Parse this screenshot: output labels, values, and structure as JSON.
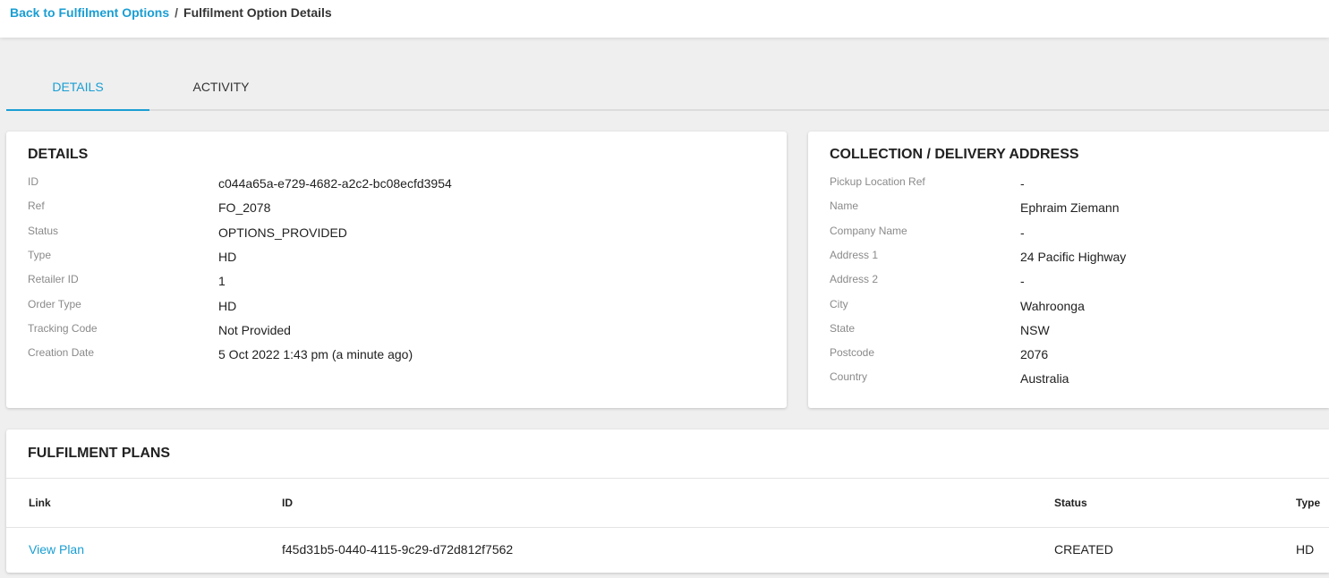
{
  "breadcrumb": {
    "back_label": "Back to Fulfilment Options",
    "separator": "/",
    "current": "Fulfilment Option Details"
  },
  "tabs": [
    {
      "label": "DETAILS",
      "active": true
    },
    {
      "label": "ACTIVITY",
      "active": false
    }
  ],
  "details": {
    "title": "DETAILS",
    "rows": [
      {
        "label": "ID",
        "value": "c044a65a-e729-4682-a2c2-bc08ecfd3954"
      },
      {
        "label": "Ref",
        "value": "FO_2078"
      },
      {
        "label": "Status",
        "value": "OPTIONS_PROVIDED"
      },
      {
        "label": "Type",
        "value": "HD"
      },
      {
        "label": "Retailer ID",
        "value": "1"
      },
      {
        "label": "Order Type",
        "value": "HD"
      },
      {
        "label": "Tracking Code",
        "value": "Not Provided"
      },
      {
        "label": "Creation Date",
        "value": "5 Oct 2022 1:43 pm (a minute ago)"
      }
    ]
  },
  "address": {
    "title": "COLLECTION / DELIVERY ADDRESS",
    "rows": [
      {
        "label": "Pickup Location Ref",
        "value": "-"
      },
      {
        "label": "Name",
        "value": "Ephraim Ziemann"
      },
      {
        "label": "Company Name",
        "value": "-"
      },
      {
        "label": "Address 1",
        "value": "24 Pacific Highway"
      },
      {
        "label": "Address 2",
        "value": "-"
      },
      {
        "label": "City",
        "value": "Wahroonga"
      },
      {
        "label": "State",
        "value": "NSW"
      },
      {
        "label": "Postcode",
        "value": "2076"
      },
      {
        "label": "Country",
        "value": "Australia"
      }
    ]
  },
  "plans": {
    "title": "FULFILMENT PLANS",
    "headers": {
      "link": "Link",
      "id": "ID",
      "status": "Status",
      "type": "Type"
    },
    "row": {
      "link": "View Plan",
      "id": "f45d31b5-0440-4115-9c29-d72d812f7562",
      "status": "CREATED",
      "type": "HD"
    }
  },
  "colors": {
    "accent": "#1a9ed3",
    "background": "#efefef"
  }
}
